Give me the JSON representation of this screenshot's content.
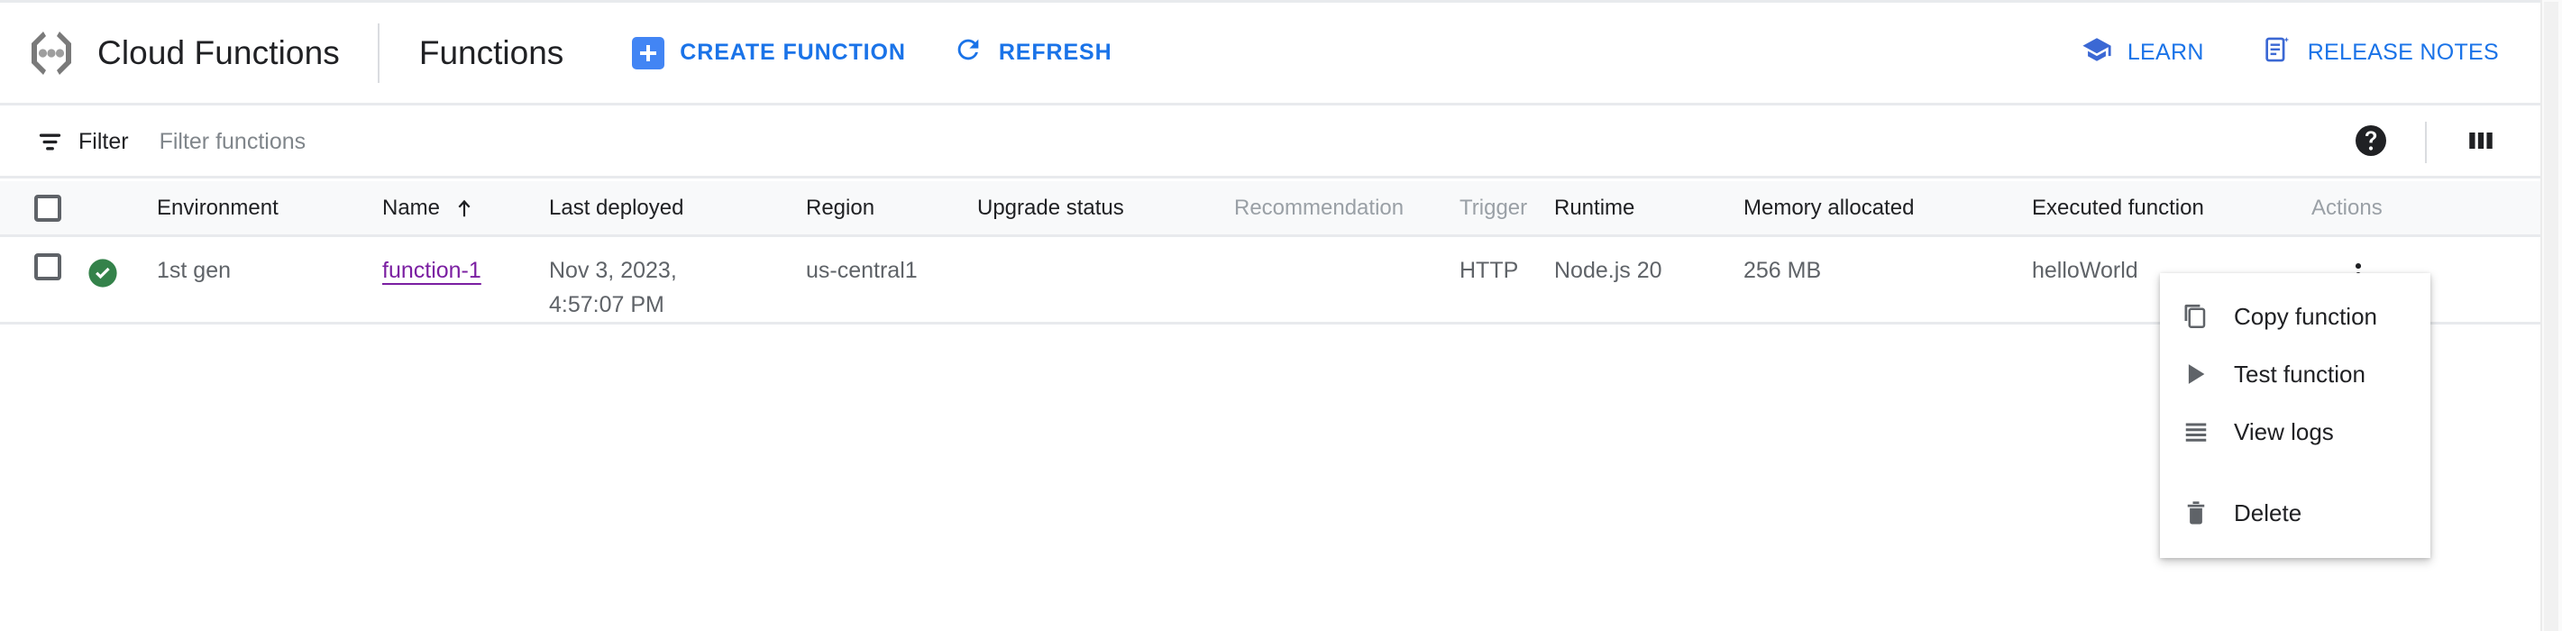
{
  "header": {
    "brand": "Cloud Functions",
    "brand_logo_icon": "cloud-functions-logo-icon",
    "page_title": "Functions",
    "actions": [
      {
        "label": "CREATE FUNCTION",
        "icon": "plus-icon"
      },
      {
        "label": "REFRESH",
        "icon": "refresh-icon"
      }
    ],
    "right_actions": [
      {
        "label": "LEARN",
        "icon": "school-cap-icon"
      },
      {
        "label": "RELEASE NOTES",
        "icon": "release-notes-icon"
      }
    ],
    "accent_color": "#1a73e8",
    "chip_color": "#4285f4"
  },
  "filterbar": {
    "filter_icon": "filter-icon",
    "filter_label": "Filter",
    "filter_placeholder": "Filter functions",
    "filter_value": "",
    "help_icon": "help-filled-icon",
    "columns_icon": "column-display-icon"
  },
  "table": {
    "columns": [
      {
        "key": "check",
        "label": "",
        "dim": false
      },
      {
        "key": "status",
        "label": "",
        "dim": false
      },
      {
        "key": "env",
        "label": "Environment",
        "dim": false
      },
      {
        "key": "name",
        "label": "Name",
        "dim": false,
        "sorted": "asc"
      },
      {
        "key": "deployed",
        "label": "Last deployed",
        "dim": false
      },
      {
        "key": "region",
        "label": "Region",
        "dim": false
      },
      {
        "key": "upgrade",
        "label": "Upgrade status",
        "dim": false
      },
      {
        "key": "recommend",
        "label": "Recommendation",
        "dim": true
      },
      {
        "key": "trigger",
        "label": "Trigger",
        "dim": true
      },
      {
        "key": "runtime",
        "label": "Runtime",
        "dim": false
      },
      {
        "key": "memory",
        "label": "Memory allocated",
        "dim": false
      },
      {
        "key": "exec",
        "label": "Executed function",
        "dim": false
      },
      {
        "key": "actions",
        "label": "Actions",
        "dim": true
      }
    ],
    "rows": [
      {
        "selected": false,
        "status_icon": "check-circle-icon",
        "status_color": "#34824a",
        "environment": "1st gen",
        "name": "function-1",
        "name_link_color": "#7b1fa2",
        "last_deployed": "Nov 3, 2023,\n4:57:07 PM",
        "region": "us-central1",
        "upgrade_status": "",
        "recommendation": "",
        "trigger": "HTTP",
        "runtime": "Node.js 20",
        "memory_allocated": "256 MB",
        "executed_function": "helloWorld",
        "actions_icon": "more-vert-icon"
      }
    ]
  },
  "context_menu": {
    "items": [
      {
        "label": "Copy function",
        "icon": "copy-icon"
      },
      {
        "label": "Test function",
        "icon": "play-icon"
      },
      {
        "label": "View logs",
        "icon": "logs-icon"
      },
      {
        "label": "Delete",
        "icon": "trash-icon"
      }
    ]
  }
}
